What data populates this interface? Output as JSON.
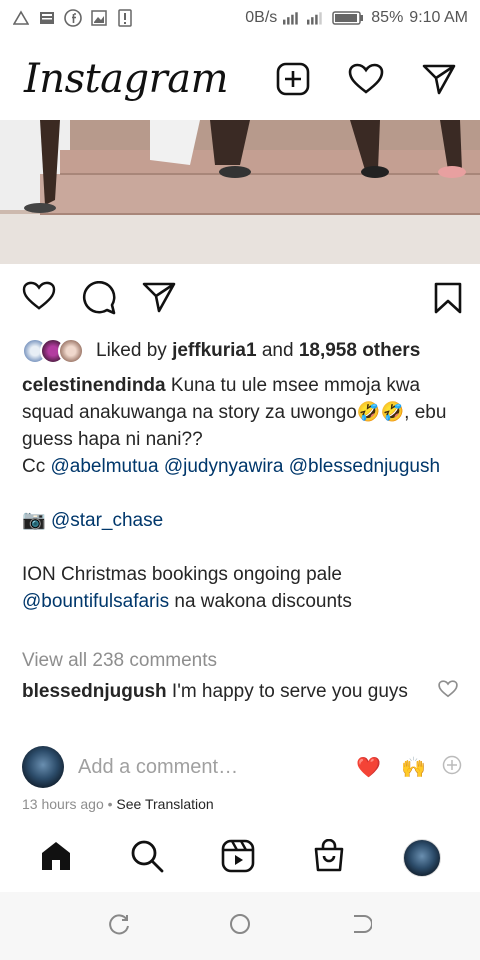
{
  "status_bar": {
    "network": "0B/s",
    "battery": "85%",
    "time": "9:10 AM"
  },
  "header": {
    "logo": "Instagram",
    "icons": [
      "new-post-icon",
      "activity-heart-icon",
      "direct-message-icon"
    ]
  },
  "post_actions": {
    "icons": [
      "like-heart-icon",
      "comment-bubble-icon",
      "share-icon",
      "bookmark-icon"
    ]
  },
  "likes": {
    "prefix": "Liked by",
    "user": "jeffkuria1",
    "and": "and",
    "count": "18,958 others"
  },
  "caption": {
    "username": "celestinendinda",
    "text_line1": "Kuna tu ule msee mmoja kwa squad anakuwanga na story za uwongo🤣🤣, ebu guess hapa ni nani??",
    "cc": "Cc",
    "mention1": "@abelmutua",
    "mention2": "@judynyawira",
    "mention3": "@blessednjugush",
    "camera": "📷",
    "photographer": "@star_chase",
    "promo_line1": "ION Christmas bookings ongoing pale",
    "promo_mention": "@bountifulsafaris",
    "promo_line2": "na wakona discounts"
  },
  "comments": {
    "view_all": "View all 238 comments",
    "top_user": "blessednjugush",
    "top_text": "I'm happy to serve you guys"
  },
  "add_comment": {
    "placeholder": "Add a comment…",
    "emoji1": "❤️",
    "emoji2": "🙌"
  },
  "meta": {
    "time_ago": "13 hours ago",
    "separator": "•",
    "see_translation": "See Translation"
  },
  "bottom_nav": [
    "home-icon",
    "search-icon",
    "reels-icon",
    "shop-icon",
    "profile-avatar"
  ]
}
